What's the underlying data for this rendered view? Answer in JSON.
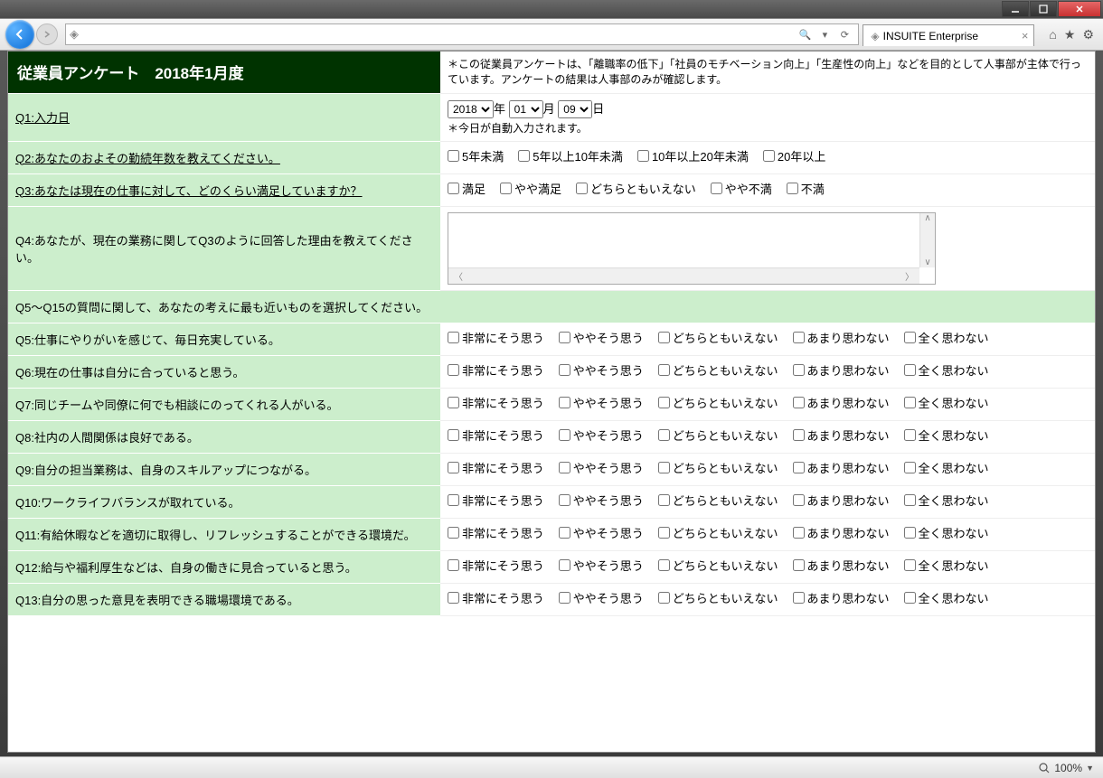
{
  "window": {
    "tab_title": "INSUITE Enterprise",
    "zoom": "100%"
  },
  "header": {
    "title": "従業員アンケート　2018年1月度",
    "note": "＊この従業員アンケートは、「離職率の低下」「社員のモチベーション向上」「生産性の向上」などを目的として人事部が主体で行っています。アンケートの結果は人事部のみが確認します。"
  },
  "q1": {
    "label": "Q1:入力日",
    "year": "2018",
    "year_suffix": "年",
    "month": "01",
    "month_suffix": "月",
    "day": "09",
    "day_suffix": "日",
    "note": "＊今日が自動入力されます。"
  },
  "q2": {
    "label": "Q2:あなたのおよその勤続年数を教えてください。",
    "opts": [
      "5年未満",
      "5年以上10年未満",
      "10年以上20年未満",
      "20年以上"
    ]
  },
  "q3": {
    "label": "Q3:あなたは現在の仕事に対して、どのくらい満足していますか？",
    "opts": [
      "満足",
      "やや満足",
      "どちらともいえない",
      "やや不満",
      "不満"
    ]
  },
  "q4": {
    "label": "Q4:あなたが、現在の業務に関してQ3のように回答した理由を教えてください。"
  },
  "section": {
    "label": "Q5～Q15の質問に関して、あなたの考えに最も近いものを選択してください。"
  },
  "likert_opts": [
    "非常にそう思う",
    "ややそう思う",
    "どちらともいえない",
    "あまり思わない",
    "全く思わない"
  ],
  "likert_questions": [
    "Q5:仕事にやりがいを感じて、毎日充実している。",
    "Q6:現在の仕事は自分に合っていると思う。",
    "Q7:同じチームや同僚に何でも相談にのってくれる人がいる。",
    "Q8:社内の人間関係は良好である。",
    "Q9:自分の担当業務は、自身のスキルアップにつながる。",
    "Q10:ワークライフバランスが取れている。",
    "Q11:有給休暇などを適切に取得し、リフレッシュすることができる環境だ。",
    "Q12:給与や福利厚生などは、自身の働きに見合っていると思う。",
    "Q13:自分の思った意見を表明できる職場環境である。"
  ]
}
